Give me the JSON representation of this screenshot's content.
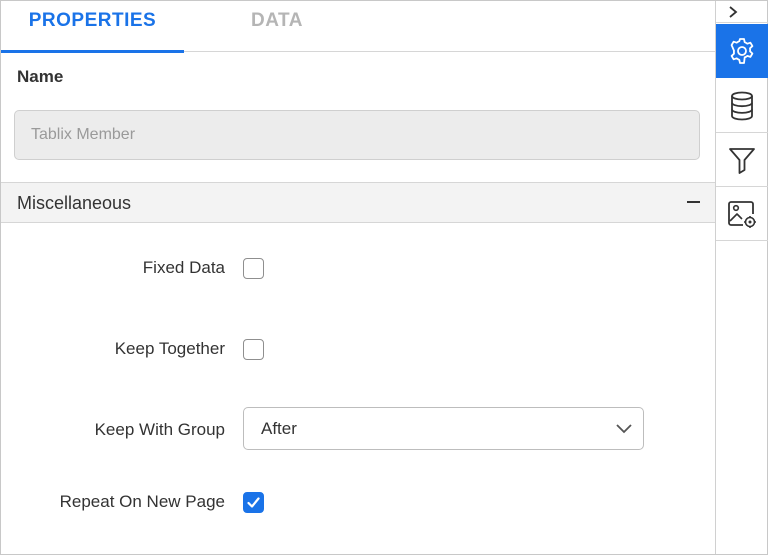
{
  "tabs": {
    "properties": "PROPERTIES",
    "data": "DATA"
  },
  "name": {
    "label": "Name",
    "value": "Tablix Member"
  },
  "section": {
    "title": "Miscellaneous"
  },
  "fields": {
    "fixed_data": {
      "label": "Fixed Data",
      "checked": false
    },
    "keep_together": {
      "label": "Keep Together",
      "checked": false
    },
    "keep_with_group": {
      "label": "Keep With Group",
      "selected": "After"
    },
    "repeat_on_new_page": {
      "label": "Repeat On New Page",
      "checked": true
    }
  },
  "sidebar": {
    "items": [
      {
        "icon": "chevron-right-icon"
      },
      {
        "icon": "gear-icon",
        "active": true
      },
      {
        "icon": "database-icon"
      },
      {
        "icon": "filter-icon"
      },
      {
        "icon": "image-settings-icon"
      }
    ]
  },
  "colors": {
    "accent": "#1a73e8",
    "inactive_tab": "#b5b5b5",
    "input_bg": "#ececec",
    "section_bg": "#f3f3f3"
  }
}
